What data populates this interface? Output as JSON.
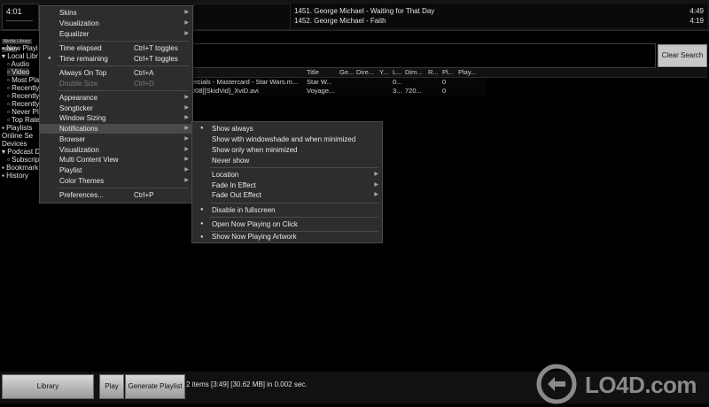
{
  "player": {
    "time": "4:01",
    "now_playing": [
      {
        "title": "1451. George Michael - Waiting for That Day",
        "duration": "4:49"
      },
      {
        "title": "1452. George Michael - Faith",
        "duration": "4:19"
      }
    ]
  },
  "sidebar": {
    "tabs": [
      "Media Library",
      "Video"
    ],
    "items": [
      {
        "label": "Now Playi"
      },
      {
        "label": "Local Libr"
      },
      {
        "label": "Audio"
      },
      {
        "label": "Video"
      },
      {
        "label": "Most Pla"
      },
      {
        "label": "Recently"
      },
      {
        "label": "Recently"
      },
      {
        "label": "Recently"
      },
      {
        "label": "Never Pl"
      },
      {
        "label": "Top Rate"
      },
      {
        "label": "Playlists"
      },
      {
        "label": "Online Se"
      },
      {
        "label": "Devices"
      },
      {
        "label": "Podcast D"
      },
      {
        "label": "Subscrip"
      },
      {
        "label": "Bookmark"
      },
      {
        "label": "History"
      }
    ]
  },
  "search": {
    "clear_label": "Clear Search"
  },
  "table": {
    "headers": [
      "Title",
      "Ge...",
      "Dire...",
      "Y...",
      "L...",
      "Dim...",
      "R...",
      "Pl...",
      "Play..."
    ],
    "rows": [
      {
        "file": "ercials - Mastercard - Star Wars.m...",
        "title": "Star W...",
        "length": "0...",
        "dim": "",
        "plays": "0"
      },
      {
        "file": "008][SkidVid]_XviD.avi",
        "title": "Voyage...",
        "length": "3...",
        "dim": "720...",
        "plays": "0"
      }
    ]
  },
  "bottom": {
    "library_label": "Library",
    "play_label": "Play",
    "generate_label": "Generate Playlist",
    "status": "2 items [3:49] [30.62 MB] in 0.002 sec."
  },
  "menu_main": {
    "items": [
      {
        "label": "Skins",
        "shortcut": "",
        "submenu": true
      },
      {
        "label": "Visualization",
        "shortcut": "",
        "submenu": true
      },
      {
        "label": "Equalizer",
        "shortcut": "",
        "submenu": true
      },
      {
        "label": "Time elapsed",
        "shortcut": "Ctrl+T toggles"
      },
      {
        "label": "Time remaining",
        "shortcut": "Ctrl+T toggles",
        "checked": true
      },
      {
        "label": "Always On Top",
        "shortcut": "Ctrl+A"
      },
      {
        "label": "Double Size",
        "shortcut": "Ctrl+D",
        "disabled": true
      },
      {
        "label": "Appearance",
        "shortcut": "",
        "submenu": true
      },
      {
        "label": "Songticker",
        "shortcut": "",
        "submenu": true
      },
      {
        "label": "Window Sizing",
        "shortcut": "",
        "submenu": true
      },
      {
        "label": "Notifications",
        "shortcut": "",
        "submenu": true,
        "highlighted": true
      },
      {
        "label": "Browser",
        "shortcut": "",
        "submenu": true
      },
      {
        "label": "Visualization",
        "shortcut": "",
        "submenu": true
      },
      {
        "label": "Multi Content View",
        "shortcut": "",
        "submenu": true
      },
      {
        "label": "Playlist",
        "shortcut": "",
        "submenu": true
      },
      {
        "label": "Color Themes",
        "shortcut": "",
        "submenu": true
      },
      {
        "label": "Preferences...",
        "shortcut": "Ctrl+P"
      }
    ]
  },
  "menu_notifications": {
    "items": [
      {
        "label": "Show always",
        "checked": true
      },
      {
        "label": "Show with windowshade and when minimized"
      },
      {
        "label": "Show only when minimized"
      },
      {
        "label": "Never show"
      },
      {
        "label": "Location",
        "submenu": true
      },
      {
        "label": "Fade In Effect",
        "submenu": true
      },
      {
        "label": "Fade Out Effect",
        "submenu": true
      },
      {
        "label": "Disable in fullscreen",
        "checked": true
      },
      {
        "label": "Open Now Playing on Click",
        "checked": true
      },
      {
        "label": "Show Now Playing Artwork",
        "checked": true
      }
    ]
  },
  "watermark": {
    "text": "LO4D.com"
  },
  "colors": {
    "background": "#000000",
    "menu_bg": "#2d2d2d",
    "menu_highlight": "#4a4a4a"
  }
}
